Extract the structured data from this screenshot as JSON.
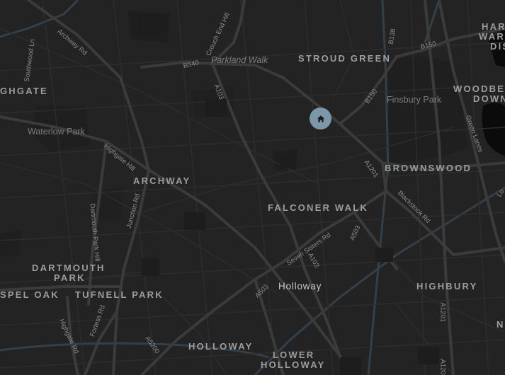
{
  "map": {
    "colors": {
      "background": "#232323",
      "block": "#282828",
      "road_major": "#3a3a3a",
      "road_minor": "#2e2e2e",
      "park": "#1e1e1e",
      "rail": "#323f49",
      "water": "#0b0b0b",
      "marker": "#7c98a8",
      "marker_icon": "#1a1a1a"
    },
    "area_labels": {
      "highgate": "GHGATE",
      "stroud_green": "STROUD GREEN",
      "harringay": "HAR",
      "harringay_2": "WARE",
      "harringay_3": "DIS",
      "woodberry_down": "WOODBE",
      "woodberry_down_2": "DOWN",
      "archway": "ARCHWAY",
      "brownswood": "BROWNSWOOD",
      "falconer_walk": "FALCONER WALK",
      "dartmouth_park": "DARTMOUTH",
      "dartmouth_park_2": "PARK",
      "gospel_oak": "SPEL OAK",
      "tufnell_park": "TUFNELL PARK",
      "highbury": "HIGHBURY",
      "holloway_area": "HOLLOWAY",
      "lower_holloway": "LOWER",
      "lower_holloway_2": "HOLLOWAY",
      "edge_n": "N"
    },
    "place_labels": {
      "parkland_walk": "Parkland Walk",
      "finsbury_park": "Finsbury Park",
      "waterlow_park": "Waterlow Park"
    },
    "town_labels": {
      "holloway": "Holloway"
    },
    "road_labels": {
      "southwood_ln": "Southwood Ln",
      "archway_rd": "Archway Rd",
      "crouch_end_hill": "Crouch End Hill",
      "b540": "B540",
      "a103_north": "A103",
      "b138": "B138",
      "b150_north": "B150",
      "b150_south": "B150",
      "green_lanes": "Green Lanes",
      "highgate_hill": "Highgate Hill",
      "a1201_north": "A1201",
      "dartmouth_park_hill": "Dartmouth Park Hill",
      "junction_rd": "Junction Rd",
      "blackstock_rd": "Blackstock Rd",
      "seven_sisters_rd": "Seven Sisters Rd",
      "a503_east": "A503",
      "a103_south": "A103",
      "a503_west": "A503",
      "highgate_rd": "Highgate Rd",
      "fortess_rd": "Fortess Rd",
      "a5200": "A5200",
      "a1201_south": "A1201",
      "a1201_bottom": "A1201",
      "edge_lo": "Lo"
    },
    "marker": {
      "icon": "home-icon"
    }
  }
}
